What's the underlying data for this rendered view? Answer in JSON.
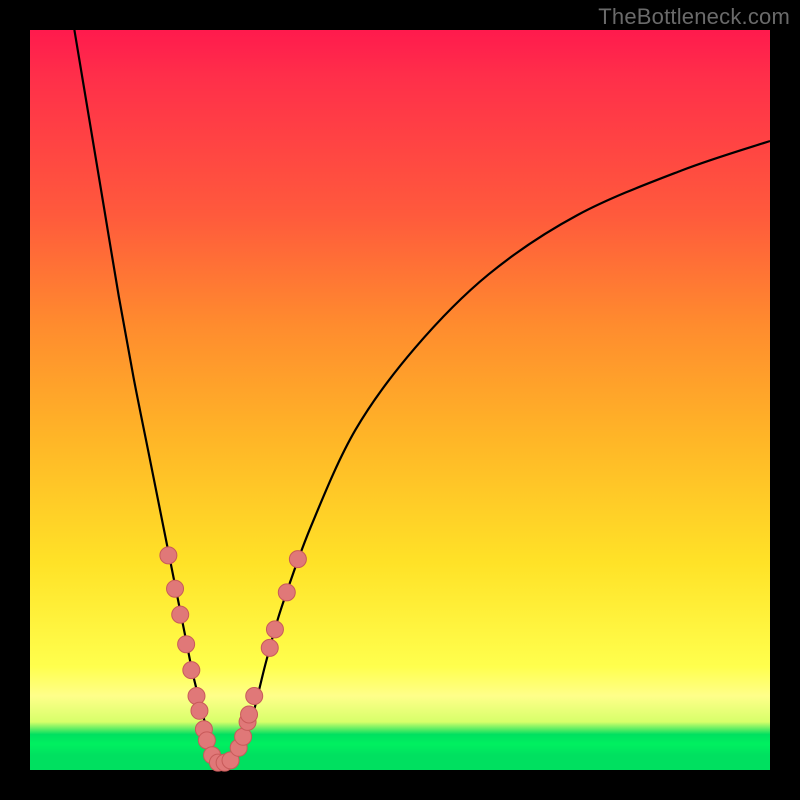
{
  "watermark": "TheBottleneck.com",
  "colors": {
    "frame": "#000000",
    "curve": "#000000",
    "marker_fill": "#e07878",
    "marker_stroke": "#c85a5a"
  },
  "chart_data": {
    "type": "line",
    "title": "",
    "xlabel": "",
    "ylabel": "",
    "xlim": [
      0,
      100
    ],
    "ylim": [
      0,
      100
    ],
    "grid": false,
    "legend": false,
    "series": [
      {
        "name": "bottleneck-curve",
        "x": [
          6,
          8,
          10,
          12,
          14,
          16,
          18,
          19,
          20,
          21,
          22,
          23,
          24,
          25,
          26,
          27,
          28,
          29,
          30,
          31,
          32,
          34,
          38,
          44,
          52,
          62,
          74,
          88,
          100
        ],
        "y": [
          100,
          88,
          76,
          64,
          53,
          43,
          33,
          28,
          23,
          18,
          13,
          9,
          5,
          2,
          1,
          1,
          2,
          4,
          7,
          11,
          15,
          22,
          33,
          46,
          57,
          67,
          75,
          81,
          85
        ]
      }
    ],
    "markers": [
      {
        "x": 18.7,
        "y": 29
      },
      {
        "x": 19.6,
        "y": 24.5
      },
      {
        "x": 20.3,
        "y": 21
      },
      {
        "x": 21.1,
        "y": 17
      },
      {
        "x": 21.8,
        "y": 13.5
      },
      {
        "x": 22.5,
        "y": 10
      },
      {
        "x": 22.9,
        "y": 8
      },
      {
        "x": 23.5,
        "y": 5.5
      },
      {
        "x": 23.9,
        "y": 4
      },
      {
        "x": 24.6,
        "y": 2
      },
      {
        "x": 25.4,
        "y": 1
      },
      {
        "x": 26.3,
        "y": 1
      },
      {
        "x": 27.1,
        "y": 1.3
      },
      {
        "x": 28.2,
        "y": 3
      },
      {
        "x": 28.8,
        "y": 4.5
      },
      {
        "x": 29.4,
        "y": 6.5
      },
      {
        "x": 29.6,
        "y": 7.5
      },
      {
        "x": 30.3,
        "y": 10
      },
      {
        "x": 32.4,
        "y": 16.5
      },
      {
        "x": 33.1,
        "y": 19
      },
      {
        "x": 34.7,
        "y": 24
      },
      {
        "x": 36.2,
        "y": 28.5
      }
    ]
  }
}
